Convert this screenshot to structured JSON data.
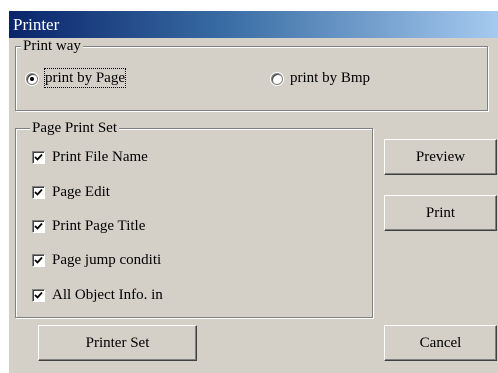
{
  "window": {
    "title": "Printer"
  },
  "print_way": {
    "legend": "Print way",
    "options": [
      {
        "label": "print by Page",
        "selected": true
      },
      {
        "label": "print by Bmp",
        "selected": false
      }
    ]
  },
  "page_print_set": {
    "legend": "Page Print Set",
    "items": [
      {
        "label": "Print File Name",
        "checked": true
      },
      {
        "label": "Page Edit",
        "checked": true
      },
      {
        "label": "Print Page Title",
        "checked": true
      },
      {
        "label": "Page jump conditi",
        "checked": true
      },
      {
        "label": "All Object Info. in",
        "checked": true
      }
    ]
  },
  "buttons": {
    "preview": "Preview",
    "print": "Print",
    "printer_set": "Printer Set",
    "cancel": "Cancel"
  },
  "colors": {
    "face": "#d4d0c8",
    "title_start": "#0a246a",
    "title_end": "#a6caf0"
  }
}
